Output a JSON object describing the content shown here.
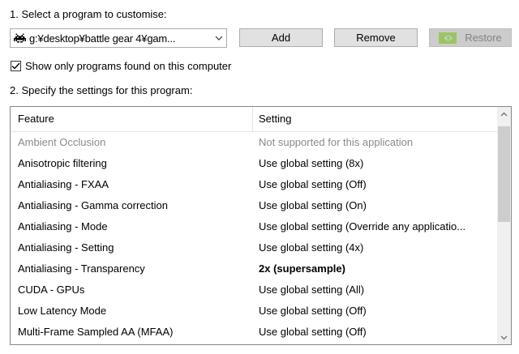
{
  "step1_label": "1. Select a program to customise:",
  "program_select": {
    "value": "g:¥desktop¥battle gear 4¥gam...",
    "icon": "game-invader-icon"
  },
  "buttons": {
    "add": "Add",
    "remove": "Remove",
    "restore": "Restore",
    "restore_icon": "nvidia-logo-icon"
  },
  "checkbox": {
    "label": "Show only programs found on this computer",
    "checked": true
  },
  "step2_label": "2. Specify the settings for this program:",
  "table": {
    "headers": {
      "feature": "Feature",
      "setting": "Setting"
    },
    "rows": [
      {
        "feature": "Ambient Occlusion",
        "setting": "Not supported for this application"
      },
      {
        "feature": "Anisotropic filtering",
        "setting": "Use global setting (8x)"
      },
      {
        "feature": "Antialiasing - FXAA",
        "setting": "Use global setting (Off)"
      },
      {
        "feature": "Antialiasing - Gamma correction",
        "setting": "Use global setting (On)"
      },
      {
        "feature": "Antialiasing - Mode",
        "setting": "Use global setting (Override any applicatio..."
      },
      {
        "feature": "Antialiasing - Setting",
        "setting": "Use global setting (4x)"
      },
      {
        "feature": "Antialiasing - Transparency",
        "setting": "2x (supersample)"
      },
      {
        "feature": "CUDA - GPUs",
        "setting": "Use global setting (All)"
      },
      {
        "feature": "Low Latency Mode",
        "setting": "Use global setting (Off)"
      },
      {
        "feature": "Multi-Frame Sampled AA (MFAA)",
        "setting": "Use global setting (Off)"
      }
    ]
  },
  "colors": {
    "disabled_text": "#8a8a8a",
    "nvidia_green": "#76b900"
  }
}
